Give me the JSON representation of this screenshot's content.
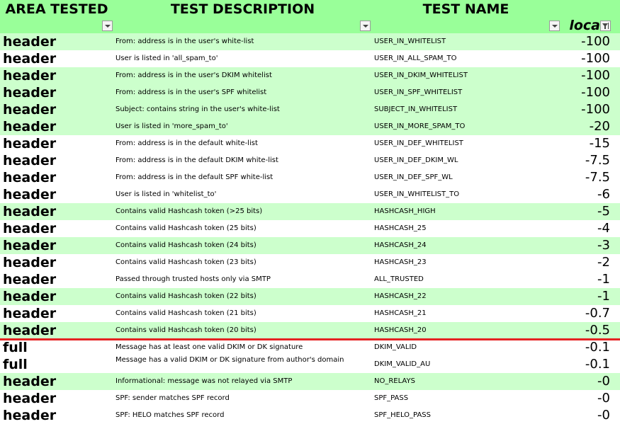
{
  "columns": {
    "area": "AREA TESTED",
    "description": "TEST DESCRIPTION",
    "name": "TEST NAME",
    "score": "loca"
  },
  "rows": [
    {
      "area": "header",
      "description": "From: address is in the user's white-list",
      "name": "USER_IN_WHITELIST",
      "score": "-100"
    },
    {
      "area": "header",
      "description": "User is listed in 'all_spam_to'",
      "name": "USER_IN_ALL_SPAM_TO",
      "score": "-100"
    },
    {
      "area": "header",
      "description": "From: address is in the user's DKIM whitelist",
      "name": "USER_IN_DKIM_WHITELIST",
      "score": "-100"
    },
    {
      "area": "header",
      "description": "From: address is in the user's SPF whitelist",
      "name": "USER_IN_SPF_WHITELIST",
      "score": "-100"
    },
    {
      "area": "header",
      "description": "Subject: contains string in the user's white-list",
      "name": "SUBJECT_IN_WHITELIST",
      "score": "-100"
    },
    {
      "area": "header",
      "description": "User is listed in 'more_spam_to'",
      "name": "USER_IN_MORE_SPAM_TO",
      "score": "-20"
    },
    {
      "area": "header",
      "description": "From: address is in the default white-list",
      "name": "USER_IN_DEF_WHITELIST",
      "score": "-15"
    },
    {
      "area": "header",
      "description": "From: address is in the default DKIM white-list",
      "name": "USER_IN_DEF_DKIM_WL",
      "score": "-7.5"
    },
    {
      "area": "header",
      "description": "From: address is in the default SPF white-list",
      "name": "USER_IN_DEF_SPF_WL",
      "score": "-7.5"
    },
    {
      "area": "header",
      "description": "User is listed in 'whitelist_to'",
      "name": "USER_IN_WHITELIST_TO",
      "score": "-6"
    },
    {
      "area": "header",
      "description": "Contains valid Hashcash token (>25 bits)",
      "name": "HASHCASH_HIGH",
      "score": "-5"
    },
    {
      "area": "header",
      "description": "Contains valid Hashcash token (25 bits)",
      "name": "HASHCASH_25",
      "score": "-4"
    },
    {
      "area": "header",
      "description": "Contains valid Hashcash token (24 bits)",
      "name": "HASHCASH_24",
      "score": "-3"
    },
    {
      "area": "header",
      "description": "Contains valid Hashcash token (23 bits)",
      "name": "HASHCASH_23",
      "score": "-2"
    },
    {
      "area": "header",
      "description": "Passed through trusted hosts only via SMTP",
      "name": "ALL_TRUSTED",
      "score": "-1"
    },
    {
      "area": "header",
      "description": "Contains valid Hashcash token (22 bits)",
      "name": "HASHCASH_22",
      "score": "-1"
    },
    {
      "area": "header",
      "description": "Contains valid Hashcash token (21 bits)",
      "name": "HASHCASH_21",
      "score": "-0.7"
    },
    {
      "area": "header",
      "description": "Contains valid Hashcash token (20 bits)",
      "name": "HASHCASH_20",
      "score": "-0.5"
    },
    {
      "area": "full",
      "description": "Message has at least one valid DKIM or DK signature",
      "name": "DKIM_VALID",
      "score": "-0.1"
    },
    {
      "area": "full",
      "description": "Message has a valid DKIM or DK signature from author's domain",
      "name": "DKIM_VALID_AU",
      "score": "-0.1"
    },
    {
      "area": "header",
      "description": "Informational: message was not relayed via SMTP",
      "name": "NO_RELAYS",
      "score": "-0"
    },
    {
      "area": "header",
      "description": "SPF: sender matches SPF record",
      "name": "SPF_PASS",
      "score": "-0"
    },
    {
      "area": "header",
      "description": "SPF: HELO matches SPF record",
      "name": "SPF_HELO_PASS",
      "score": "-0"
    }
  ],
  "row_colors": [
    "green",
    "white",
    "green",
    "green",
    "green",
    "green",
    "white",
    "white",
    "white",
    "white",
    "green",
    "white",
    "green",
    "white",
    "white",
    "green",
    "white",
    "green",
    "white",
    "white",
    "green",
    "white",
    "white"
  ],
  "icons": {
    "area_filter": "dropdown-arrow-icon",
    "description_filter": "dropdown-arrow-icon",
    "name_filter": "dropdown-arrow-icon",
    "score_filter": "filter-sort-icon"
  },
  "colors": {
    "header_bg": "#99ff99",
    "row_green": "#ccffcc",
    "row_white": "#ffffff",
    "separator": "#e52222"
  }
}
